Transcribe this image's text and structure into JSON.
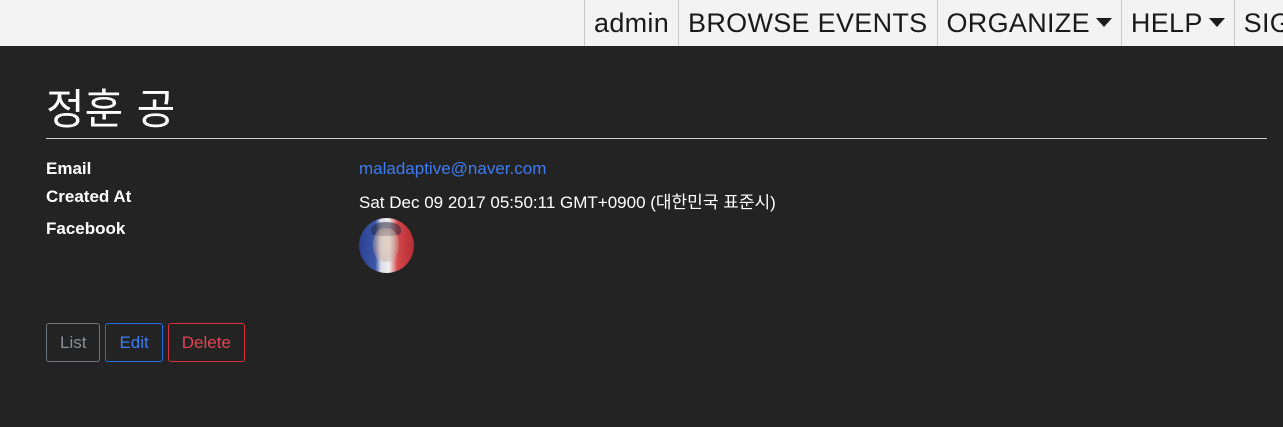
{
  "nav": {
    "items": [
      {
        "label": "admin",
        "dropdown": false
      },
      {
        "label": "BROWSE EVENTS",
        "dropdown": false
      },
      {
        "label": "ORGANIZE",
        "dropdown": true
      },
      {
        "label": "HELP",
        "dropdown": true
      },
      {
        "label": "SIGN OUT",
        "dropdown": false
      }
    ]
  },
  "page": {
    "title": "정훈 공"
  },
  "details": {
    "email_label": "Email",
    "email_value": "maladaptive@naver.com",
    "created_label": "Created At",
    "created_value": "Sat Dec 09 2017 05:50:11 GMT+0900 (대한민국 표준시)",
    "facebook_label": "Facebook"
  },
  "actions": {
    "list_label": "List",
    "edit_label": "Edit",
    "delete_label": "Delete"
  },
  "colors": {
    "background": "#232323",
    "topbar": "#f3f3f3",
    "link": "#3d7cf0",
    "secondary": "#6c757d",
    "primary": "#1f6fe5",
    "danger": "#d7303f"
  }
}
